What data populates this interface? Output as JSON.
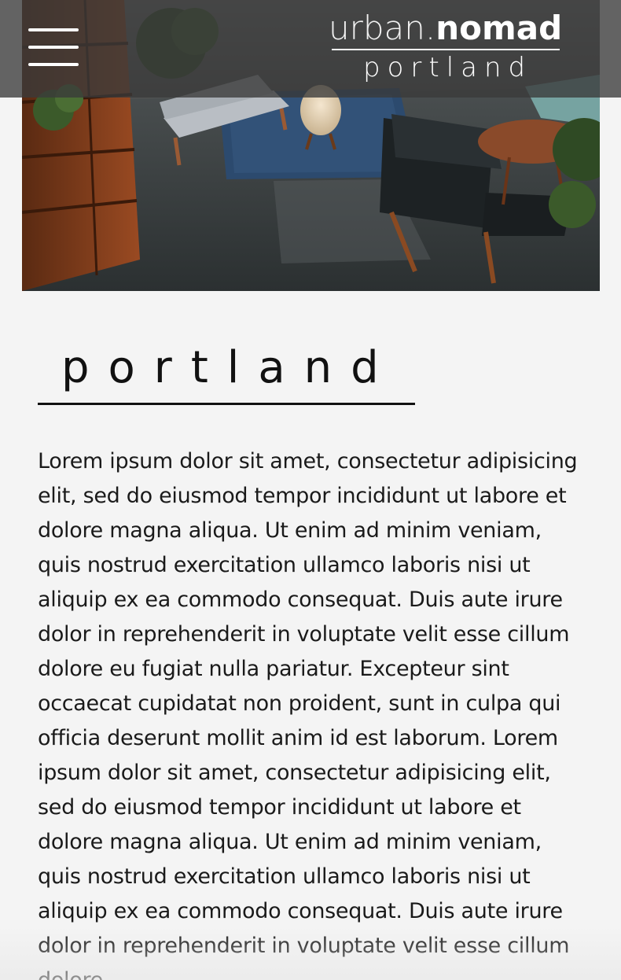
{
  "header": {
    "brand_thin": "urban.",
    "brand_bold": "nomad",
    "brand_sub": "portland",
    "menu_icon": "hamburger-menu-icon"
  },
  "hero": {
    "image": "interior-lounge-photo"
  },
  "main": {
    "title": "portland",
    "body": "Lorem ipsum dolor sit amet, consectetur adipisicing elit, sed do eiusmod tempor incididunt ut labore et dolore magna aliqua. Ut enim ad minim veniam, quis nostrud exercitation ullamco laboris nisi ut aliquip ex ea commodo consequat. Duis aute irure dolor in reprehenderit in voluptate velit esse cillum dolore eu fugiat nulla pariatur. Excepteur sint occaecat cupidatat non proident, sunt in culpa qui officia deserunt mollit anim id est laborum. Lorem ipsum dolor sit amet, consectetur adipisicing elit, sed do eiusmod tempor incididunt ut labore et dolore magna aliqua. Ut enim ad minim veniam, quis nostrud exercitation ullamco laboris nisi ut aliquip ex ea commodo consequat. Duis aute irure dolor in reprehenderit in voluptate velit esse cillum dolore"
  },
  "colors": {
    "background": "#f4f4f4",
    "header_overlay": "#3a3a3a",
    "text": "#1a1a1a",
    "brand_text": "#ffffff"
  }
}
